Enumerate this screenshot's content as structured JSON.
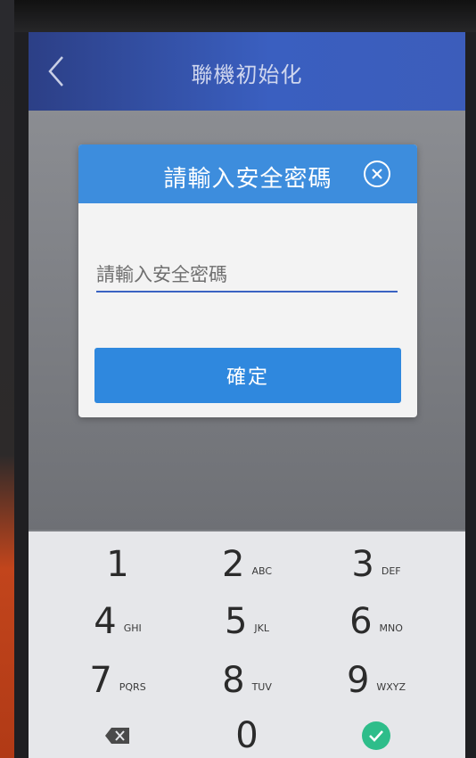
{
  "header": {
    "title": "聯機初始化",
    "back_icon": "chevron-left-icon"
  },
  "dialog": {
    "title": "請輸入安全密碼",
    "close_icon": "close-circle-icon",
    "input_placeholder": "請輸入安全密碼",
    "input_value": "",
    "confirm_label": "確定"
  },
  "keypad": {
    "keys": [
      {
        "digit": "1",
        "letters": ""
      },
      {
        "digit": "2",
        "letters": "ABC"
      },
      {
        "digit": "3",
        "letters": "DEF"
      },
      {
        "digit": "4",
        "letters": "GHI"
      },
      {
        "digit": "5",
        "letters": "JKL"
      },
      {
        "digit": "6",
        "letters": "MNO"
      },
      {
        "digit": "7",
        "letters": "PQRS"
      },
      {
        "digit": "8",
        "letters": "TUV"
      },
      {
        "digit": "9",
        "letters": "WXYZ"
      },
      {
        "digit": "0",
        "letters": ""
      }
    ],
    "delete_icon": "backspace-icon",
    "done_icon": "check-circle-icon"
  },
  "colors": {
    "header_blue": "#3a5fc0",
    "dialog_blue": "#3d8ddd",
    "button_blue": "#2f88de",
    "check_green": "#2ebd8a"
  }
}
